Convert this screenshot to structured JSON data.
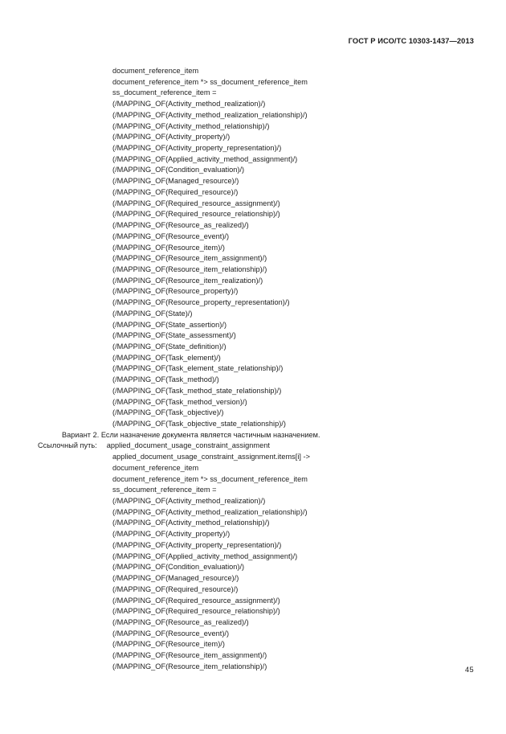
{
  "document": {
    "running_head": "ГОСТ Р ИСО/ТС 10303-1437—2013",
    "page_number": "45"
  },
  "content": {
    "lines": [
      {
        "indent": "code",
        "text": "document_reference_item"
      },
      {
        "indent": "code",
        "text": "document_reference_item *> ss_document_reference_item"
      },
      {
        "indent": "code",
        "text": "ss_document_reference_item ="
      },
      {
        "indent": "code",
        "text": "(/MAPPING_OF(Activity_method_realization)/)"
      },
      {
        "indent": "code",
        "text": "(/MAPPING_OF(Activity_method_realization_relationship)/)"
      },
      {
        "indent": "code",
        "text": "(/MAPPING_OF(Activity_method_relationship)/)"
      },
      {
        "indent": "code",
        "text": "(/MAPPING_OF(Activity_property)/)"
      },
      {
        "indent": "code",
        "text": "(/MAPPING_OF(Activity_property_representation)/)"
      },
      {
        "indent": "code",
        "text": "(/MAPPING_OF(Applied_activity_method_assignment)/)"
      },
      {
        "indent": "code",
        "text": "(/MAPPING_OF(Condition_evaluation)/)"
      },
      {
        "indent": "code",
        "text": "(/MAPPING_OF(Managed_resource)/)"
      },
      {
        "indent": "code",
        "text": "(/MAPPING_OF(Required_resource)/)"
      },
      {
        "indent": "code",
        "text": "(/MAPPING_OF(Required_resource_assignment)/)"
      },
      {
        "indent": "code",
        "text": "(/MAPPING_OF(Required_resource_relationship)/)"
      },
      {
        "indent": "code",
        "text": "(/MAPPING_OF(Resource_as_realized)/)"
      },
      {
        "indent": "code",
        "text": "(/MAPPING_OF(Resource_event)/)"
      },
      {
        "indent": "code",
        "text": "(/MAPPING_OF(Resource_item)/)"
      },
      {
        "indent": "code",
        "text": "(/MAPPING_OF(Resource_item_assignment)/)"
      },
      {
        "indent": "code",
        "text": "(/MAPPING_OF(Resource_item_relationship)/)"
      },
      {
        "indent": "code",
        "text": "(/MAPPING_OF(Resource_item_realization)/)"
      },
      {
        "indent": "code",
        "text": "(/MAPPING_OF(Resource_property)/)"
      },
      {
        "indent": "code",
        "text": "(/MAPPING_OF(Resource_property_representation)/)"
      },
      {
        "indent": "code",
        "text": "(/MAPPING_OF(State)/)"
      },
      {
        "indent": "code",
        "text": "(/MAPPING_OF(State_assertion)/)"
      },
      {
        "indent": "code",
        "text": "(/MAPPING_OF(State_assessment)/)"
      },
      {
        "indent": "code",
        "text": "(/MAPPING_OF(State_definition)/)"
      },
      {
        "indent": "code",
        "text": "(/MAPPING_OF(Task_element)/)"
      },
      {
        "indent": "code",
        "text": "(/MAPPING_OF(Task_element_state_relationship)/)"
      },
      {
        "indent": "code",
        "text": "(/MAPPING_OF(Task_method)/)"
      },
      {
        "indent": "code",
        "text": "(/MAPPING_OF(Task_method_state_relationship)/)"
      },
      {
        "indent": "code",
        "text": "(/MAPPING_OF(Task_method_version)/)"
      },
      {
        "indent": "code",
        "text": "(/MAPPING_OF(Task_objective)/)"
      },
      {
        "indent": "code",
        "text": "(/MAPPING_OF(Task_objective_state_relationship)/)"
      },
      {
        "indent": "variant",
        "text": "Вариант 2. Если назначение документа является частичным назначением."
      },
      {
        "indent": "refpath",
        "label": "Ссылочный путь:",
        "text": "applied_document_usage_constraint_assignment"
      },
      {
        "indent": "code",
        "text": "applied_document_usage_constraint_assignment.items[i] ->"
      },
      {
        "indent": "code",
        "text": "document_reference_item"
      },
      {
        "indent": "code",
        "text": "document_reference_item *> ss_document_reference_item"
      },
      {
        "indent": "code",
        "text": "ss_document_reference_item ="
      },
      {
        "indent": "code",
        "text": "(/MAPPING_OF(Activity_method_realization)/)"
      },
      {
        "indent": "code",
        "text": "(/MAPPING_OF(Activity_method_realization_relationship)/)"
      },
      {
        "indent": "code",
        "text": "(/MAPPING_OF(Activity_method_relationship)/)"
      },
      {
        "indent": "code",
        "text": "(/MAPPING_OF(Activity_property)/)"
      },
      {
        "indent": "code",
        "text": "(/MAPPING_OF(Activity_property_representation)/)"
      },
      {
        "indent": "code",
        "text": "(/MAPPING_OF(Applied_activity_method_assignment)/)"
      },
      {
        "indent": "code",
        "text": "(/MAPPING_OF(Condition_evaluation)/)"
      },
      {
        "indent": "code",
        "text": "(/MAPPING_OF(Managed_resource)/)"
      },
      {
        "indent": "code",
        "text": "(/MAPPING_OF(Required_resource)/)"
      },
      {
        "indent": "code",
        "text": "(/MAPPING_OF(Required_resource_assignment)/)"
      },
      {
        "indent": "code",
        "text": "(/MAPPING_OF(Required_resource_relationship)/)"
      },
      {
        "indent": "code",
        "text": "(/MAPPING_OF(Resource_as_realized)/)"
      },
      {
        "indent": "code",
        "text": "(/MAPPING_OF(Resource_event)/)"
      },
      {
        "indent": "code",
        "text": "(/MAPPING_OF(Resource_item)/)"
      },
      {
        "indent": "code",
        "text": "(/MAPPING_OF(Resource_item_assignment)/)"
      },
      {
        "indent": "code",
        "text": "(/MAPPING_OF(Resource_item_relationship)/)"
      }
    ]
  }
}
